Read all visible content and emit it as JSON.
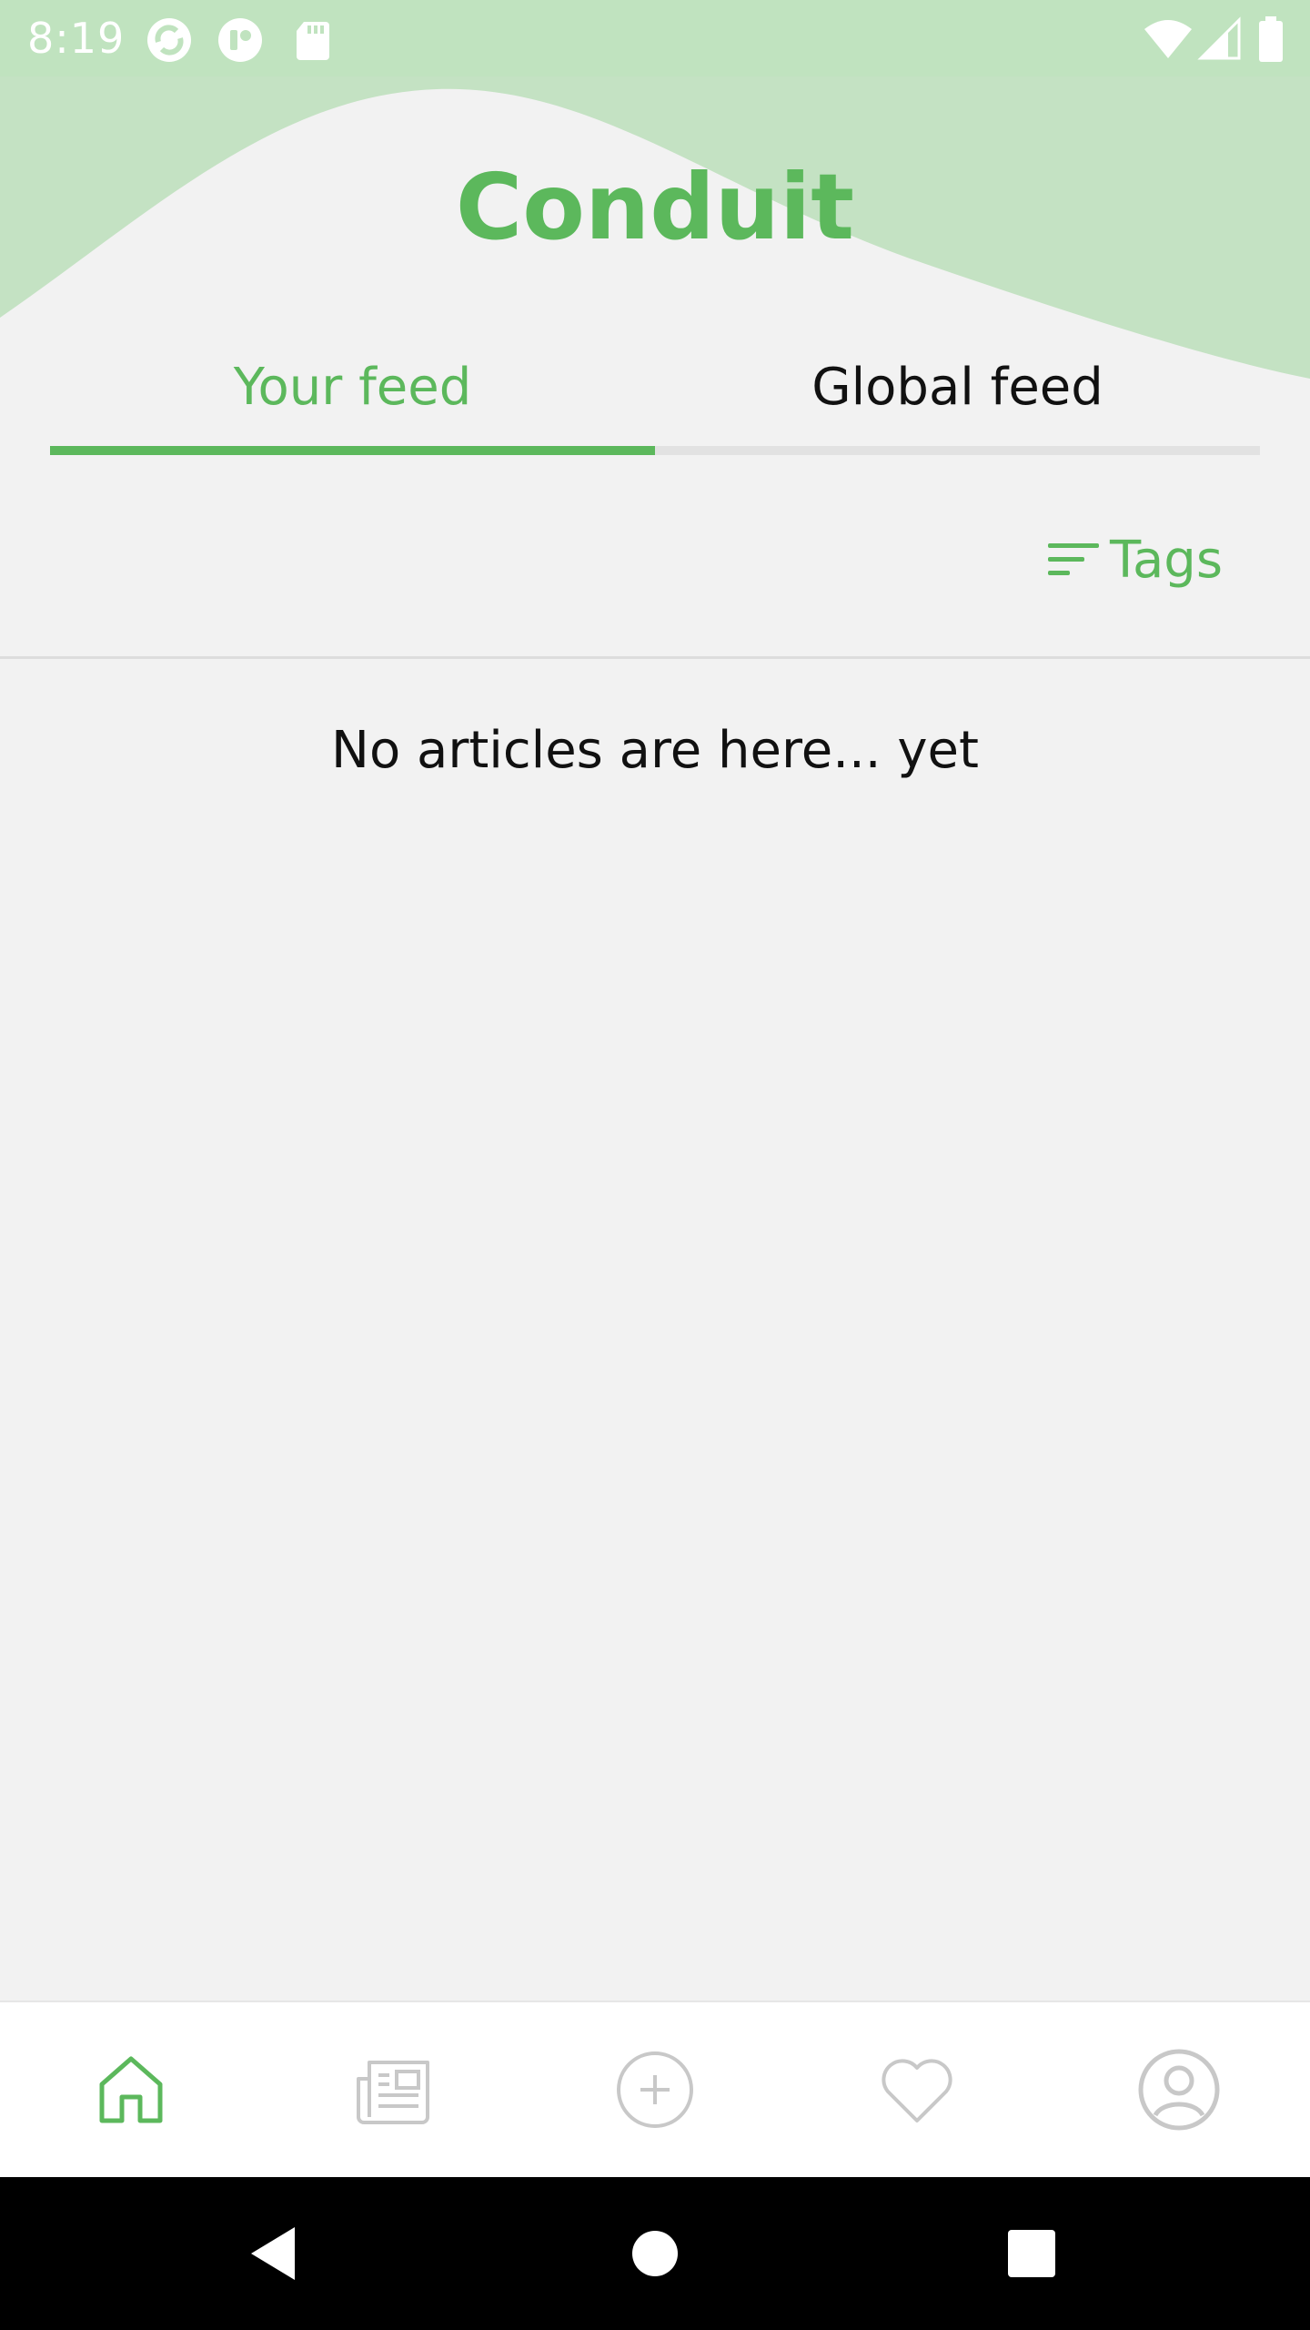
{
  "status_bar": {
    "time": "8:19",
    "color": "#c0e3bf",
    "left_icons": [
      "sync-app-icon",
      "notification-app-icon",
      "sd-card-icon"
    ],
    "right_icons": [
      "wifi-icon",
      "cellular-signal-icon",
      "battery-icon"
    ]
  },
  "header": {
    "app_title": "Conduit"
  },
  "tabs": [
    {
      "label": "Your feed",
      "selected": true
    },
    {
      "label": "Global feed",
      "selected": false
    }
  ],
  "filter": {
    "tags_label": "Tags",
    "icon": "filter-list-icon"
  },
  "feed": {
    "empty_message": "No articles are here... yet"
  },
  "bottom_nav": [
    {
      "icon": "home-icon",
      "selected": true
    },
    {
      "icon": "newspaper-icon",
      "selected": false
    },
    {
      "icon": "add-circle-icon",
      "selected": false
    },
    {
      "icon": "heart-icon",
      "selected": false
    },
    {
      "icon": "account-circle-icon",
      "selected": false
    }
  ],
  "system_nav": [
    "back-icon",
    "home-circle-icon",
    "recents-icon"
  ],
  "colors": {
    "accent": "#5cb85c",
    "header_wave": "#c4e2c3",
    "background": "#f2f2f2",
    "inactive_icon": "#c8c8c8"
  }
}
